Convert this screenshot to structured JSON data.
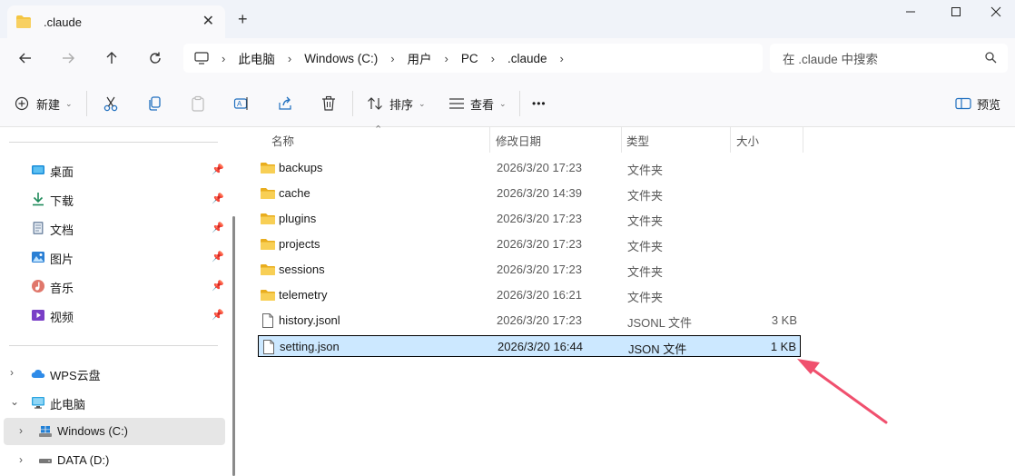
{
  "window": {
    "tab_title": ".claude",
    "tab_close": "✕",
    "new_tab": "+",
    "minimize": "—",
    "maximize": "☐",
    "close": "✕"
  },
  "breadcrumb": [
    "此电脑",
    "Windows (C:)",
    "用户",
    "PC",
    ".claude"
  ],
  "search": {
    "placeholder": "在 .claude 中搜索"
  },
  "commands": {
    "new": "新建",
    "sort": "排序",
    "view": "查看",
    "more": "•••",
    "preview": "预览"
  },
  "sidebar": {
    "quick_access": [
      {
        "label": "桌面",
        "icon": "desktop-icon"
      },
      {
        "label": "下载",
        "icon": "download-icon"
      },
      {
        "label": "文档",
        "icon": "document-icon"
      },
      {
        "label": "图片",
        "icon": "pictures-icon"
      },
      {
        "label": "音乐",
        "icon": "music-icon"
      },
      {
        "label": "视频",
        "icon": "video-icon"
      }
    ],
    "tree": [
      {
        "label": "WPS云盘",
        "icon": "cloud-icon",
        "expanded": false
      },
      {
        "label": "此电脑",
        "icon": "computer-icon",
        "expanded": true
      },
      {
        "label": "Windows (C:)",
        "icon": "windows-drive-icon",
        "expanded": false,
        "selected": true
      },
      {
        "label": "DATA (D:)",
        "icon": "drive-icon",
        "expanded": false
      }
    ]
  },
  "columns": {
    "name": "名称",
    "modified": "修改日期",
    "type": "类型",
    "size": "大小"
  },
  "files": [
    {
      "name": "backups",
      "modified": "2026/3/20 17:23",
      "type": "文件夹",
      "size": "",
      "kind": "folder"
    },
    {
      "name": "cache",
      "modified": "2026/3/20 14:39",
      "type": "文件夹",
      "size": "",
      "kind": "folder"
    },
    {
      "name": "plugins",
      "modified": "2026/3/20 17:23",
      "type": "文件夹",
      "size": "",
      "kind": "folder"
    },
    {
      "name": "projects",
      "modified": "2026/3/20 17:23",
      "type": "文件夹",
      "size": "",
      "kind": "folder"
    },
    {
      "name": "sessions",
      "modified": "2026/3/20 17:23",
      "type": "文件夹",
      "size": "",
      "kind": "folder"
    },
    {
      "name": "telemetry",
      "modified": "2026/3/20 16:21",
      "type": "文件夹",
      "size": "",
      "kind": "folder"
    },
    {
      "name": "history.jsonl",
      "modified": "2026/3/20 17:23",
      "type": "JSONL 文件",
      "size": "3 KB",
      "kind": "file"
    },
    {
      "name": "setting.json",
      "modified": "2026/3/20 16:44",
      "type": "JSON 文件",
      "size": "1 KB",
      "kind": "file",
      "selected": true
    }
  ],
  "colors": {
    "folder": "#f4c542",
    "selection": "#cce8ff",
    "annotation_arrow": "#f0506e",
    "accent": "#0067c0"
  }
}
